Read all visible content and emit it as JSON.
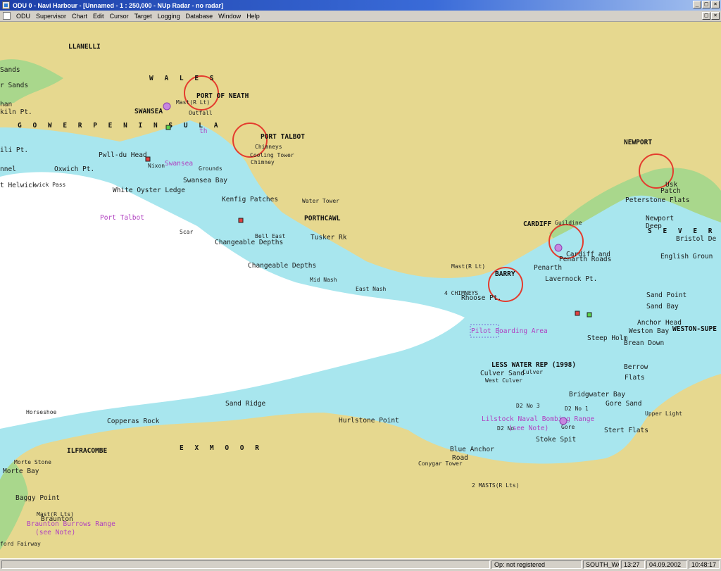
{
  "window": {
    "title": "ODU 0 - Navi Harbour - [Unnamed - 1 : 250,000 - NUp  Radar - no radar]",
    "controls": [
      "_",
      "□",
      "×"
    ]
  },
  "menu": [
    "ODU",
    "Supervisor",
    "Chart",
    "Edit",
    "Cursor",
    "Target",
    "Logging",
    "Database",
    "Window",
    "Help"
  ],
  "map": {
    "colors": {
      "land": "#e6d88f",
      "shallow": "#a8e6ee",
      "deep": "#ffffff",
      "marsh": "#a9d78c",
      "highlight_circle": "#e43c2e",
      "magenta": "#b03fc0"
    },
    "places": {
      "llanelli": "LLANELLI",
      "wales": "W A L E S",
      "port_of_neath": "PORT OF NEATH",
      "swansea": "SWANSEA",
      "port_talbot": "PORT TALBOT",
      "gower": "G O W E R   P E N I N S U L A",
      "newport": "NEWPORT",
      "cardiff": "CARDIFF",
      "porthcawl": "PORTHCAWL",
      "barry": "BARRY",
      "ilfracombe": "ILFRACOMBE",
      "exmoor": "E X M O O R",
      "severn": "S E V E R N  E",
      "weston": "WESTON-SUPE"
    },
    "features": {
      "sands": "Sands",
      "r_sands": "r Sands",
      "han": "han",
      "kiln": "kiln Pt.",
      "ili": "ili Pt.",
      "nnel": "nnel",
      "helwick": "t Helwick",
      "helwick_pass": "wick Pass",
      "pwll": "Pwll-du Head",
      "oxwich": "Oxwich Pt.",
      "white_oyster": "White Oyster Ledge",
      "swansea_bay": "Swansea Bay",
      "kenfig": "Kenfig Patches",
      "changeable1": "Changeable Depths",
      "changeable2": "Changeable Depths",
      "tusker": "Tusker Rk",
      "mid_nash": "Mid Nash",
      "east_nash": "East Nash",
      "chimneys": "4 CHIMNEYS",
      "rhoose": "Rhoose Pt.",
      "penarth": "Penarth",
      "lavernock": "Lavernock Pt.",
      "cardiff_roads": "Cardiff and",
      "penarth_roads": "Penarth Roads",
      "peterstone": "Peterstone Flats",
      "usk_patch": "Usk",
      "usk_patch2": "Patch",
      "newport_deep": "Newport",
      "newport_deep2": "Deep",
      "bristol": "Bristol De",
      "english_grounds": "English Groun",
      "sand_point": "Sand Point",
      "sand_bay": "Sand Bay",
      "anchor_head": "Anchor Head",
      "weston_bay": "Weston Bay",
      "brean": "Brean Down",
      "steep_holm": "Steep Holm",
      "berrow": "Berrow",
      "flats": "Flats",
      "bridgwater": "Bridgwater Bay",
      "gore_sand": "Gore Sand",
      "stert": "Stert Flats",
      "stoke_spit": "Stoke Spit",
      "blue_anchor": "Blue Anchor",
      "road": "Road",
      "hurlstone": "Hurlstone Point",
      "sand_ridge": "Sand Ridge",
      "copperas": "Copperas Rock",
      "horseshoe": "Horseshoe",
      "morte_stone": "Morte Stone",
      "morte_bay": "Morte Bay",
      "baggy": "Baggy Point",
      "braunton": "Braunton",
      "fairway": "ford Fairway",
      "culver_sand": "Culver Sand",
      "less_water": "LESS WATER REP (1998)",
      "west_culver": "West Culver",
      "east_culver": "Culver",
      "d2_no3": "D2 No 3",
      "d2_no1": "D2 No 1",
      "d2_note": "D2 No",
      "gore": "Gore",
      "upper_light": "Upper Light",
      "mast_lt": "Mast(R Lt)",
      "mast_lt2": "Mast(R Lt)",
      "mast_lt3": "Mast(R Lts)",
      "masts": "2 MASTS(R Lts)",
      "conygar": "Conygar Tower",
      "water_tower": "Water Tower",
      "outfall": "Outfall",
      "cooling": "Cooling Tower",
      "chimney": "Chimney",
      "chimneys_pt": "Chimneys",
      "nixon": "Nixon",
      "grounds": "Grounds",
      "scar": "Scar",
      "bell_east": "Bell East",
      "guildine": "Guildine"
    },
    "magenta_labels": {
      "port_talbot_anch": "Port Talbot",
      "swansea_anch": "Swansea",
      "pilot": "Pilot Boarding Area",
      "lilstock": "Lilstock Naval Bombing Range",
      "see_note": "(see Note)",
      "braunton_range": "Braunton Burrows Range",
      "braunton_note": "(see Note)",
      "neath_anch": "th"
    }
  },
  "status": {
    "empty": "",
    "op": "Op: not registered",
    "area": "SOUTH_WALI",
    "time1": "13:27",
    "date": "04.09.2002",
    "time2": "10:48:17"
  }
}
